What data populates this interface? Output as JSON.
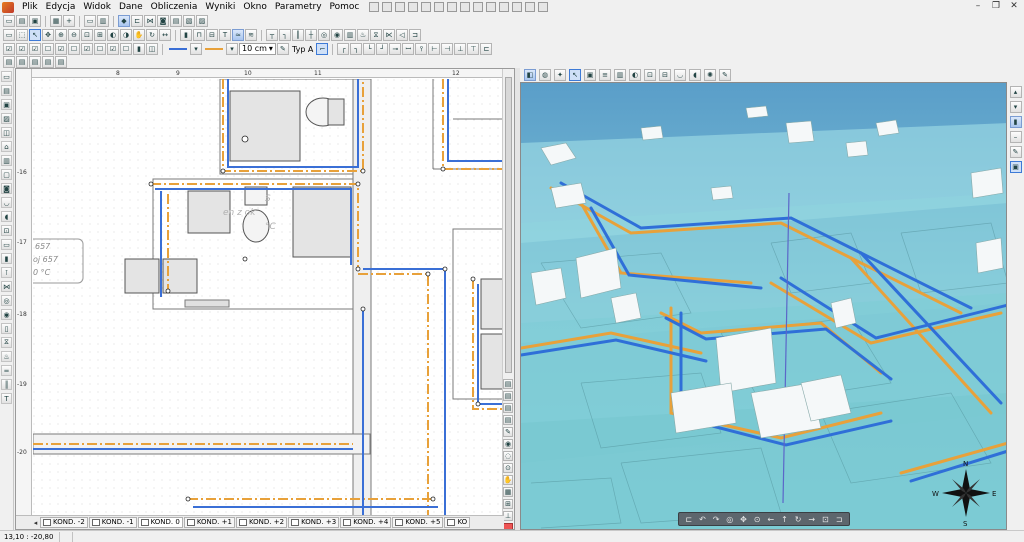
{
  "menu": {
    "items": [
      "Plik",
      "Edycja",
      "Widok",
      "Dane",
      "Obliczenia",
      "Wyniki",
      "Okno",
      "Parametry",
      "Pomoc"
    ]
  },
  "toolbar": {
    "line_width": "10 cm",
    "type_label": "Typ A"
  },
  "ruler": {
    "top_ticks": [
      "8",
      "9",
      "10",
      "11",
      "12"
    ],
    "left_ticks": [
      "-16",
      "-17",
      "-18",
      "-19",
      "-20"
    ],
    "scale": "130"
  },
  "plan": {
    "room_labels": [
      "657",
      "oj 657",
      "0 °C"
    ],
    "ghost_label_1": "S",
    "ghost_label_2": "en  z ok",
    "ghost_label_3": "°C"
  },
  "floor_tabs": [
    "KOND. -2",
    "KOND. -1",
    "KOND. 0",
    "KOND. +1",
    "KOND. +2",
    "KOND. +3",
    "KOND. +4",
    "KOND. +5",
    "KO"
  ],
  "compass": {
    "labels": [
      "N",
      "E",
      "S",
      "W"
    ]
  },
  "status": {
    "coordinates": "13,10 : -20,80"
  },
  "colors": {
    "pipe_orange": "#e8a13a",
    "pipe_blue": "#3a6fd6",
    "water3d": "#7fd0da"
  }
}
